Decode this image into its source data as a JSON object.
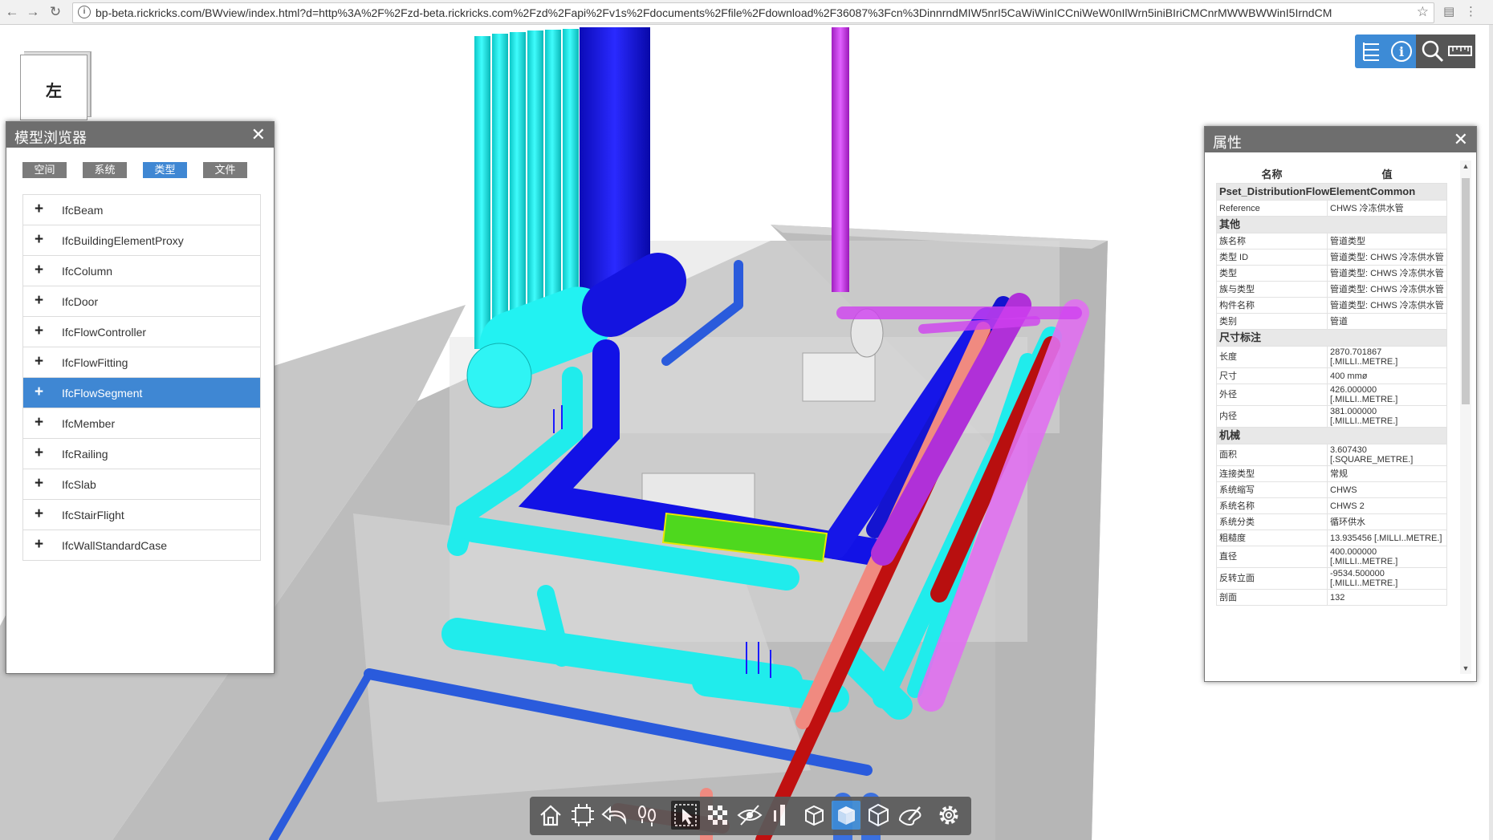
{
  "browser_chrome": {
    "back_icon": "arrow-left",
    "forward_icon": "arrow-right",
    "reload_icon": "reload",
    "url": "bp-beta.rickricks.com/BWview/index.html?d=http%3A%2F%2Fzd-beta.rickricks.com%2Fzd%2Fapi%2Fv1s%2Fdocuments%2Ffile%2Fdownload%2F36087%3Fcn%3DinnrndMIW5nrI5CaWiWinICCniWeW0nIlWrn5iniBIriCMCnrMWWBWWinI5IrndCM"
  },
  "viewcube": {
    "face_label": "左"
  },
  "top_toolbar": {
    "items": [
      "model-tree-icon",
      "info-icon",
      "search-icon",
      "measure-icon"
    ]
  },
  "model_browser": {
    "title": "模型浏览器",
    "close_label": "✕",
    "tabs": [
      {
        "label": "空间",
        "active": false
      },
      {
        "label": "系统",
        "active": false
      },
      {
        "label": "类型",
        "active": true
      },
      {
        "label": "文件",
        "active": false
      }
    ],
    "items": [
      {
        "expand": "+",
        "label": "IfcBeam"
      },
      {
        "expand": "+",
        "label": "IfcBuildingElementProxy"
      },
      {
        "expand": "+",
        "label": "IfcColumn"
      },
      {
        "expand": "+",
        "label": "IfcDoor"
      },
      {
        "expand": "+",
        "label": "IfcFlowController"
      },
      {
        "expand": "+",
        "label": "IfcFlowFitting"
      },
      {
        "expand": "+",
        "label": "IfcFlowSegment",
        "selected": true
      },
      {
        "expand": "+",
        "label": "IfcMember"
      },
      {
        "expand": "+",
        "label": "IfcRailing"
      },
      {
        "expand": "+",
        "label": "IfcSlab"
      },
      {
        "expand": "+",
        "label": "IfcStairFlight"
      },
      {
        "expand": "+",
        "label": "IfcWallStandardCase"
      }
    ]
  },
  "properties": {
    "title": "属性",
    "close_label": "✕",
    "col_name": "名称",
    "col_value": "值",
    "scroll_up": "▲",
    "scroll_down": "▼",
    "groups": [
      {
        "name": "Pset_DistributionFlowElementCommon",
        "rows": [
          {
            "k": "Reference",
            "v": "CHWS 冷冻供水管"
          }
        ]
      },
      {
        "name": "其他",
        "rows": [
          {
            "k": "族名称",
            "v": "管道类型"
          },
          {
            "k": "类型 ID",
            "v": "管道类型: CHWS 冷冻供水管"
          },
          {
            "k": "类型",
            "v": "管道类型: CHWS 冷冻供水管"
          },
          {
            "k": "族与类型",
            "v": "管道类型: CHWS 冷冻供水管"
          },
          {
            "k": "构件名称",
            "v": "管道类型: CHWS 冷冻供水管"
          },
          {
            "k": "类别",
            "v": "管道"
          }
        ]
      },
      {
        "name": "尺寸标注",
        "rows": [
          {
            "k": "长度",
            "v": "2870.701867 [.MILLI..METRE.]"
          },
          {
            "k": "尺寸",
            "v": "400 mmø"
          },
          {
            "k": "外径",
            "v": "426.000000 [.MILLI..METRE.]"
          },
          {
            "k": "内径",
            "v": "381.000000 [.MILLI..METRE.]"
          }
        ]
      },
      {
        "name": "机械",
        "rows": [
          {
            "k": "面积",
            "v": "3.607430 [.SQUARE_METRE.]"
          },
          {
            "k": "连接类型",
            "v": "常规"
          },
          {
            "k": "系统缩写",
            "v": "CHWS"
          },
          {
            "k": "系统名称",
            "v": "CHWS 2"
          },
          {
            "k": "系统分类",
            "v": "循环供水"
          },
          {
            "k": "粗糙度",
            "v": "13.935456 [.MILLI..METRE.]"
          },
          {
            "k": "直径",
            "v": "400.000000 [.MILLI..METRE.]"
          },
          {
            "k": "反转立面",
            "v": "-9534.500000 [.MILLI..METRE.]"
          },
          {
            "k": "剖面",
            "v": "132"
          }
        ]
      }
    ]
  },
  "bottom_toolbar": {
    "items": [
      {
        "icon": "home-icon",
        "state": ""
      },
      {
        "icon": "fit-view-icon",
        "state": ""
      },
      {
        "icon": "orbit-icon",
        "state": ""
      },
      {
        "icon": "walk-icon",
        "state": ""
      },
      {
        "icon": "select-icon",
        "state": "active"
      },
      {
        "icon": "section-icon",
        "state": ""
      },
      {
        "icon": "hide-icon",
        "state": ""
      },
      {
        "icon": "isolate-icon",
        "state": ""
      },
      {
        "icon": "box-icon",
        "state": ""
      },
      {
        "icon": "view-box-icon",
        "state": "sel"
      },
      {
        "icon": "explode-icon",
        "state": ""
      },
      {
        "icon": "render-icon",
        "state": ""
      },
      {
        "icon": "settings-icon",
        "state": ""
      }
    ]
  },
  "colors": {
    "accent": "#3d8bd6",
    "panel_header": "#6e6e6e",
    "pipe_cyan": "#1ef0f0",
    "pipe_blue": "#1616e6",
    "pipe_magenta": "#d23cf0",
    "pipe_red": "#c81414",
    "pipe_salmon": "#f08c80",
    "selected_pipe": "#4ed81e"
  }
}
